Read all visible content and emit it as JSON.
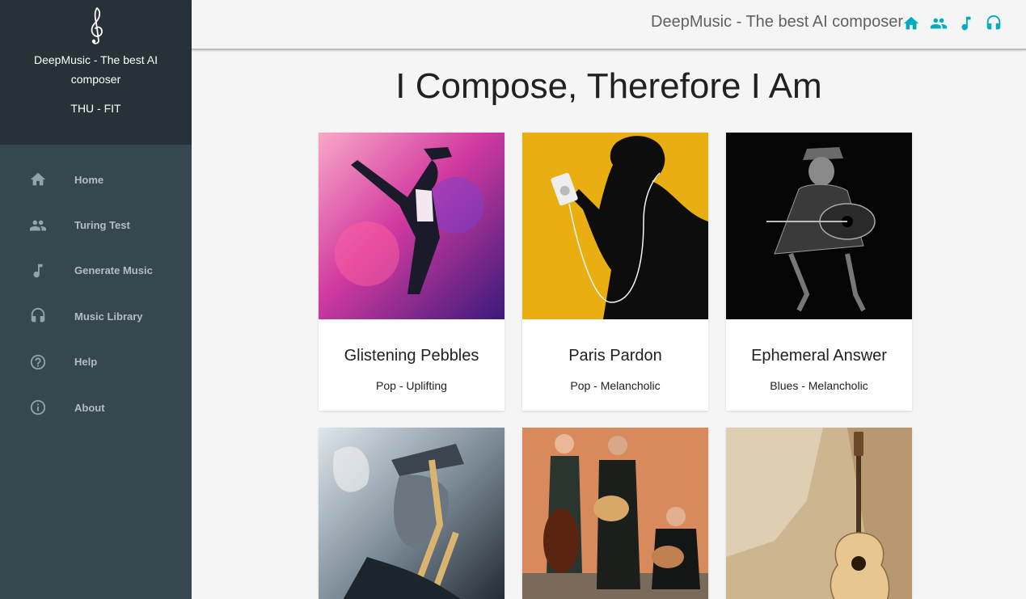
{
  "sidebar": {
    "brand_title": "DeepMusic - The best AI composer",
    "brand_subtitle": "THU - FIT",
    "logo_icon": "treble-clef-icon",
    "items": [
      {
        "label": "Home",
        "icon": "home-icon"
      },
      {
        "label": "Turing Test",
        "icon": "people-icon"
      },
      {
        "label": "Generate Music",
        "icon": "music-note-icon"
      },
      {
        "label": "Music Library",
        "icon": "headphones-icon"
      },
      {
        "label": "Help",
        "icon": "help-icon"
      },
      {
        "label": "About",
        "icon": "info-icon"
      }
    ]
  },
  "topbar": {
    "title": "DeepMusic - The best AI composer",
    "icons": [
      "home-icon",
      "people-icon",
      "music-note-icon",
      "headphones-icon"
    ],
    "accent": "#00acc1"
  },
  "main": {
    "heading": "I Compose, Therefore I Am",
    "cards": [
      {
        "title": "Glistening Pebbles",
        "genre": "Pop - Uplifting"
      },
      {
        "title": "Paris Pardon",
        "genre": "Pop - Melancholic"
      },
      {
        "title": "Ephemeral Answer",
        "genre": "Blues - Melancholic"
      },
      {
        "title": "",
        "genre": ""
      },
      {
        "title": "",
        "genre": ""
      },
      {
        "title": "",
        "genre": ""
      }
    ]
  },
  "colors": {
    "sidebar_bg": "#37474f",
    "brand_bg": "#263238",
    "page_bg": "#f5f5f5"
  }
}
